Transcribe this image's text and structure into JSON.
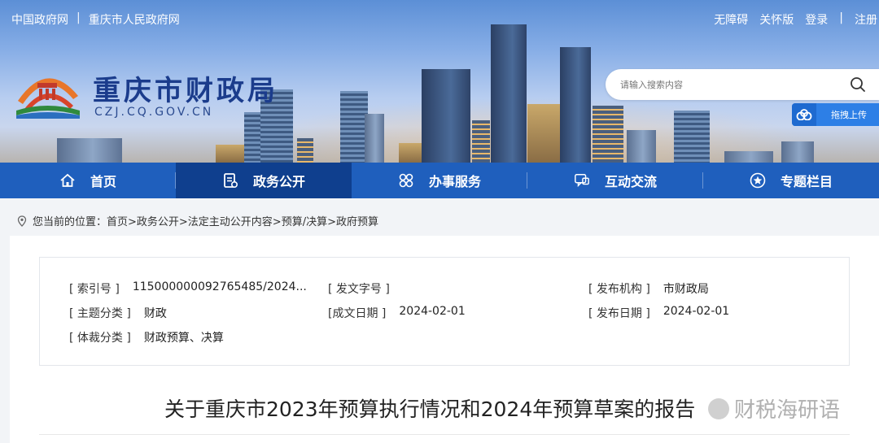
{
  "header": {
    "top_links": [
      "中国政府网",
      "|",
      "重庆市人民政府网"
    ],
    "right_links": [
      "无障碍",
      "关怀版",
      "登录",
      "|",
      "注册"
    ],
    "site_title": "重庆市财政局",
    "site_domain": "CZJ.CQ.GOV.CN",
    "search_placeholder": "请输入搜索内容",
    "upload_label": "拖拽上传"
  },
  "nav": {
    "items": [
      {
        "label": "首页",
        "icon": "home-icon"
      },
      {
        "label": "政务公开",
        "icon": "document-icon"
      },
      {
        "label": "办事服务",
        "icon": "service-grid-icon"
      },
      {
        "label": "互动交流",
        "icon": "chat-icon"
      },
      {
        "label": "专题栏目",
        "icon": "star-icon"
      }
    ],
    "active_index": 1
  },
  "breadcrumb": {
    "prefix": "您当前的位置：",
    "path": "首页>政务公开>法定主动公开内容>预算/决算>政府预算"
  },
  "meta": {
    "index_no_label": "[ 索引号 ]",
    "index_no": "115000000092765485/2024...",
    "doc_no_label": "[ 发文字号 ]",
    "doc_no": "",
    "publisher_label": "[ 发布机构 ]",
    "publisher": "市财政局",
    "topic_label": "[ 主题分类 ]",
    "topic": "财政",
    "created_label": "[成文日期 ]",
    "created": "2024-02-01",
    "published_label": "[ 发布日期 ]",
    "published": "2024-02-01",
    "genre_label": "[ 体裁分类 ]",
    "genre": "财政预算、决算"
  },
  "article": {
    "title": "关于重庆市2023年预算执行情况和2024年预算草案的报告"
  },
  "watermark": "财税海研语",
  "colors": {
    "nav_bg": "#1f5fbd",
    "nav_active": "#0f3f8e",
    "title_blue": "#1b3c8c",
    "upload_blue": "#2d7fe6"
  }
}
